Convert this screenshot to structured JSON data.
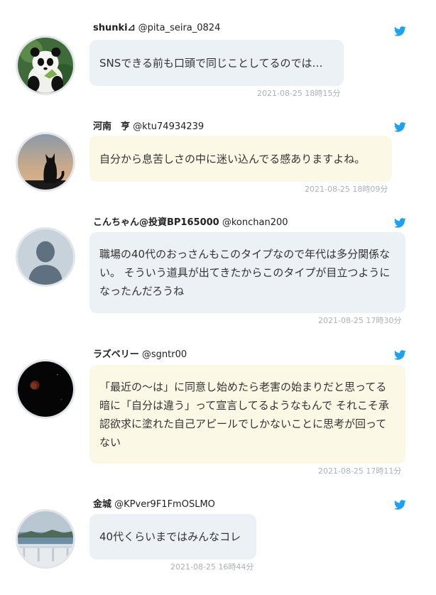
{
  "colors": {
    "bubble_blue": "#ebf1f4",
    "bubble_cream": "#fcf8e6",
    "twitter_blue": "#1da1f2",
    "timestamp": "#aab2b8"
  },
  "tweets": [
    {
      "name": "shunki⊿",
      "handle": "@pita_seira_0824",
      "text": "SNSできる前も口頭で同じことしてるのでは…",
      "timestamp": "2021-08-25 18時15分",
      "avatar_icon": "panda-avatar"
    },
    {
      "name": "河南　亨",
      "handle": "@ktu74934239",
      "text": "自分から息苦しさの中に迷い込んでる感ありますよね。",
      "timestamp": "2021-08-25 18時09分",
      "avatar_icon": "cat-silhouette-avatar"
    },
    {
      "name": "こんちゃん@投資BP165000",
      "handle": "@konchan200",
      "text": "職場の40代のおっさんもこのタイプなので年代は多分関係ない。 そういう道具が出てきたからこのタイプが目立つようになったんだろうね",
      "timestamp": "2021-08-25 17時30分",
      "avatar_icon": "default-person-avatar"
    },
    {
      "name": "ラズベリー",
      "handle": "@sgntr00",
      "text": "「最近の〜は」に同意し始めたら老害の始まりだと思ってる 暗に「自分は違う」って宣言してるようなもんで それこそ承認欲求に塗れた自己アピールでしかないことに思考が回ってない",
      "timestamp": "2021-08-25 17時11分",
      "avatar_icon": "eclipse-moon-avatar"
    },
    {
      "name": "金城",
      "handle": "@KPver9F1FmOSLMO",
      "text": "40代くらいまではみんなコレ",
      "timestamp": "2021-08-25 16時44分",
      "avatar_icon": "seaside-avatar"
    }
  ]
}
